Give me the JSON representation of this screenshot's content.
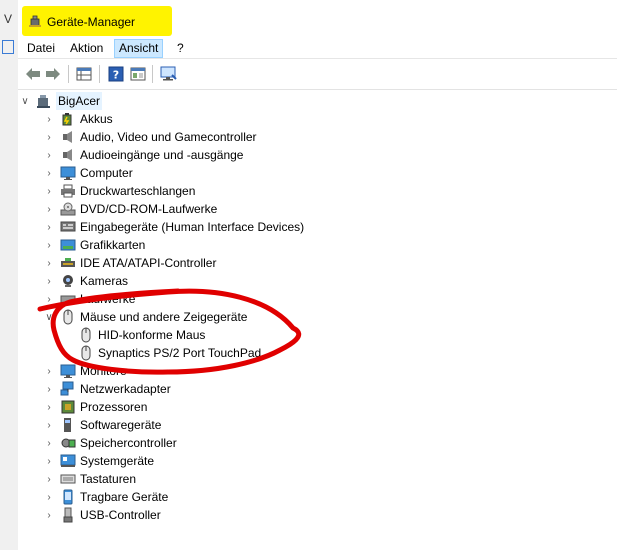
{
  "window": {
    "title": "Geräte-Manager"
  },
  "menu": {
    "items": [
      "Datei",
      "Aktion",
      "Ansicht",
      "?"
    ],
    "active_index": 2
  },
  "toolbar": {
    "buttons": [
      "back-arrow-icon",
      "forward-arrow-icon",
      "properties-grid-icon",
      "help-icon",
      "console-icon",
      "monitor-scan-icon"
    ]
  },
  "tree": {
    "root": {
      "label": "BigAcer",
      "icon": "computer-icon"
    },
    "items": [
      {
        "label": "Akkus",
        "icon": "battery-icon",
        "expanded": false
      },
      {
        "label": "Audio, Video und Gamecontroller",
        "icon": "speaker-icon",
        "expanded": false
      },
      {
        "label": "Audioeingänge und -ausgänge",
        "icon": "speaker-icon",
        "expanded": false
      },
      {
        "label": "Computer",
        "icon": "monitor-icon",
        "expanded": false
      },
      {
        "label": "Druckwarteschlangen",
        "icon": "printer-icon",
        "expanded": false
      },
      {
        "label": "DVD/CD-ROM-Laufwerke",
        "icon": "disc-drive-icon",
        "expanded": false
      },
      {
        "label": "Eingabegeräte (Human Interface Devices)",
        "icon": "hid-icon",
        "expanded": false
      },
      {
        "label": "Grafikkarten",
        "icon": "graphics-card-icon",
        "expanded": false
      },
      {
        "label": "IDE ATA/ATAPI-Controller",
        "icon": "ide-controller-icon",
        "expanded": false
      },
      {
        "label": "Kameras",
        "icon": "camera-icon",
        "expanded": false
      },
      {
        "label": "Laufwerke",
        "icon": "drive-icon",
        "expanded": false
      },
      {
        "label": "Mäuse und andere Zeigegeräte",
        "icon": "mouse-icon",
        "expanded": true,
        "children": [
          {
            "label": "HID-konforme Maus",
            "icon": "mouse-icon"
          },
          {
            "label": "Synaptics PS/2 Port TouchPad",
            "icon": "mouse-icon"
          }
        ]
      },
      {
        "label": "Monitore",
        "icon": "monitor-icon",
        "expanded": false
      },
      {
        "label": "Netzwerkadapter",
        "icon": "network-adapter-icon",
        "expanded": false
      },
      {
        "label": "Prozessoren",
        "icon": "processor-icon",
        "expanded": false
      },
      {
        "label": "Softwaregeräte",
        "icon": "software-device-icon",
        "expanded": false
      },
      {
        "label": "Speichercontroller",
        "icon": "storage-controller-icon",
        "expanded": false
      },
      {
        "label": "Systemgeräte",
        "icon": "system-device-icon",
        "expanded": false
      },
      {
        "label": "Tastaturen",
        "icon": "keyboard-icon",
        "expanded": false
      },
      {
        "label": "Tragbare Geräte",
        "icon": "portable-device-icon",
        "expanded": false
      },
      {
        "label": "USB-Controller",
        "icon": "usb-icon",
        "expanded": false
      }
    ]
  },
  "colors": {
    "title_highlight": "#fff300",
    "annotation": "#e00000",
    "selection": "#e5f3ff"
  }
}
